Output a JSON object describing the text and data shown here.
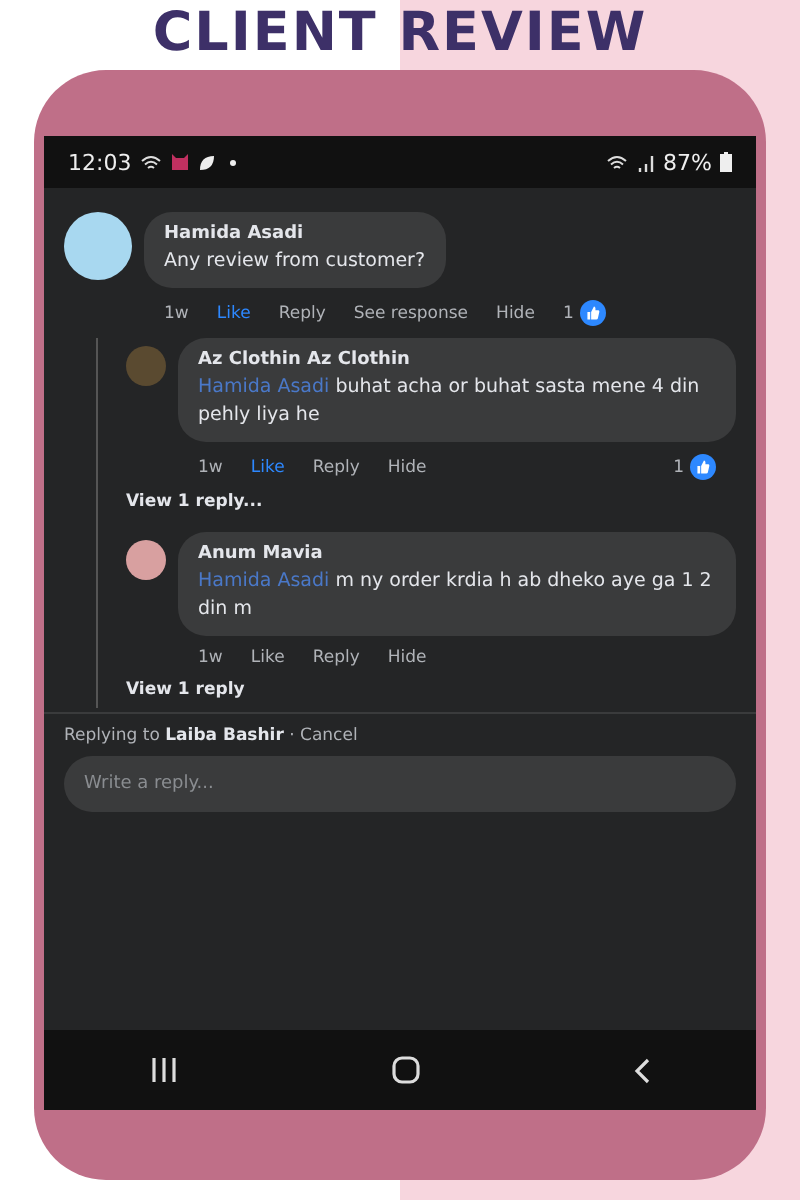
{
  "title": "CLIENT REVIEW",
  "status_bar": {
    "time": "12:03",
    "battery": "87%"
  },
  "comment": {
    "author": "Hamida Asadi",
    "text": "Any review from customer?",
    "time": "1w",
    "like": "Like",
    "liked": true,
    "reply": "Reply",
    "see_response": "See response",
    "hide": "Hide",
    "like_count": "1",
    "replies": [
      {
        "author": "Az Clothin Az Clothin",
        "mention": "Hamida Asadi",
        "text": "buhat acha or buhat sasta mene 4 din pehly liya he",
        "time": "1w",
        "like": "Like",
        "liked": true,
        "reply": "Reply",
        "hide": "Hide",
        "like_count": "1",
        "view_replies": "View 1 reply..."
      },
      {
        "author": "Anum Mavia",
        "mention": "Hamida Asadi",
        "text": "m ny order krdia h ab dheko aye ga 1 2 din m",
        "time": "1w",
        "like": "Like",
        "liked": false,
        "reply": "Reply",
        "hide": "Hide",
        "view_replies": "View 1 reply"
      }
    ]
  },
  "reply_bar": {
    "prefix": "Replying to",
    "name": "Laiba Bashir",
    "separator": "·",
    "cancel": "Cancel",
    "placeholder": "Write a reply..."
  }
}
